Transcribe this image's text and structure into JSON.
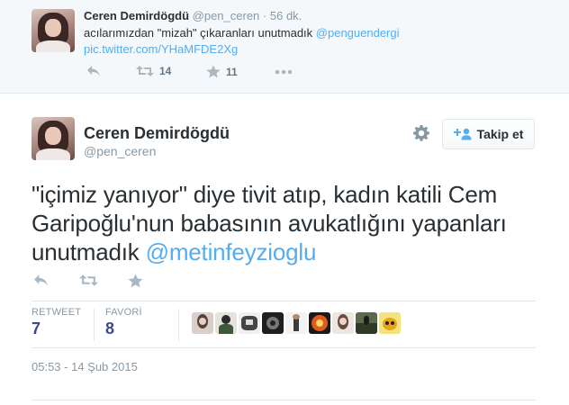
{
  "top_tweet": {
    "name": "Ceren Demirdögdü",
    "handle": "@pen_ceren",
    "separator": "·",
    "time": "56 dk.",
    "text_plain": "acılarımızdan \"mizah\" çıkaranları unutmadık ",
    "mention": "@penguendergi",
    "pic_link": "pic.twitter.com/YHaMFDE2Xg",
    "retweet_count": "14",
    "favorite_count": "11"
  },
  "main_tweet": {
    "name": "Ceren Demirdögdü",
    "handle": "@pen_ceren",
    "follow_label": "Takip et",
    "text_plain": "\"içimiz yanıyor\" diye tivit atıp, kadın katili Cem Garipoğlu'nun babasının avukatlığını yapanları unutmadık ",
    "mention": "@metinfeyzioglu",
    "stats": {
      "retweet_label": "RETWEET",
      "retweet_value": "7",
      "favorite_label": "FAVORİ",
      "favorite_value": "8"
    },
    "date": "05:53 - 14 Şub 2015"
  },
  "colors": {
    "link": "#55acee",
    "muted": "#8899a6",
    "text": "#292f33",
    "stat_value": "#3b4b8a"
  },
  "icons": [
    "reply-icon",
    "retweet-icon",
    "favorite-icon",
    "more-icon",
    "gear-icon",
    "follow-person-icon"
  ]
}
